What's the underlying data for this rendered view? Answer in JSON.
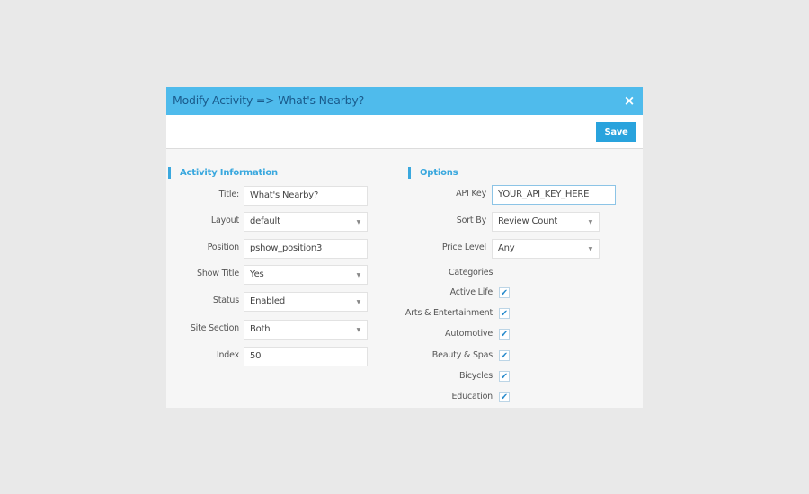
{
  "modal": {
    "title": "Modify Activity => What's Nearby?",
    "close_icon": "×",
    "save_label": "Save"
  },
  "activity_info": {
    "section_title": "Activity Information",
    "fields": [
      {
        "label": "Title:",
        "type": "text",
        "value": "What's Nearby?"
      },
      {
        "label": "Layout",
        "type": "select",
        "value": "default"
      },
      {
        "label": "Position",
        "type": "text",
        "value": "pshow_position3"
      },
      {
        "label": "Show Title",
        "type": "select",
        "value": "Yes"
      },
      {
        "label": "Status",
        "type": "select",
        "value": "Enabled"
      },
      {
        "label": "Site Section",
        "type": "select",
        "value": "Both"
      },
      {
        "label": "Index",
        "type": "text",
        "value": "50"
      }
    ]
  },
  "options": {
    "section_title": "Options",
    "api_key": {
      "label": "API Key",
      "value": "YOUR_API_KEY_HERE"
    },
    "sort_by": {
      "label": "Sort By",
      "value": "Review Count"
    },
    "price_level": {
      "label": "Price Level",
      "value": "Any"
    },
    "categories_label": "Categories",
    "categories": [
      {
        "label": "Active Life",
        "checked": true
      },
      {
        "label": "Arts & Entertainment",
        "checked": true
      },
      {
        "label": "Automotive",
        "checked": true
      },
      {
        "label": "Beauty & Spas",
        "checked": true
      },
      {
        "label": "Bicycles",
        "checked": true
      },
      {
        "label": "Education",
        "checked": true
      }
    ],
    "check_glyph": "✔"
  },
  "caret_glyph": "▼",
  "colors": {
    "header_bg": "#4fbbec",
    "accent": "#29a3dd",
    "section_title": "#3aa8de"
  }
}
